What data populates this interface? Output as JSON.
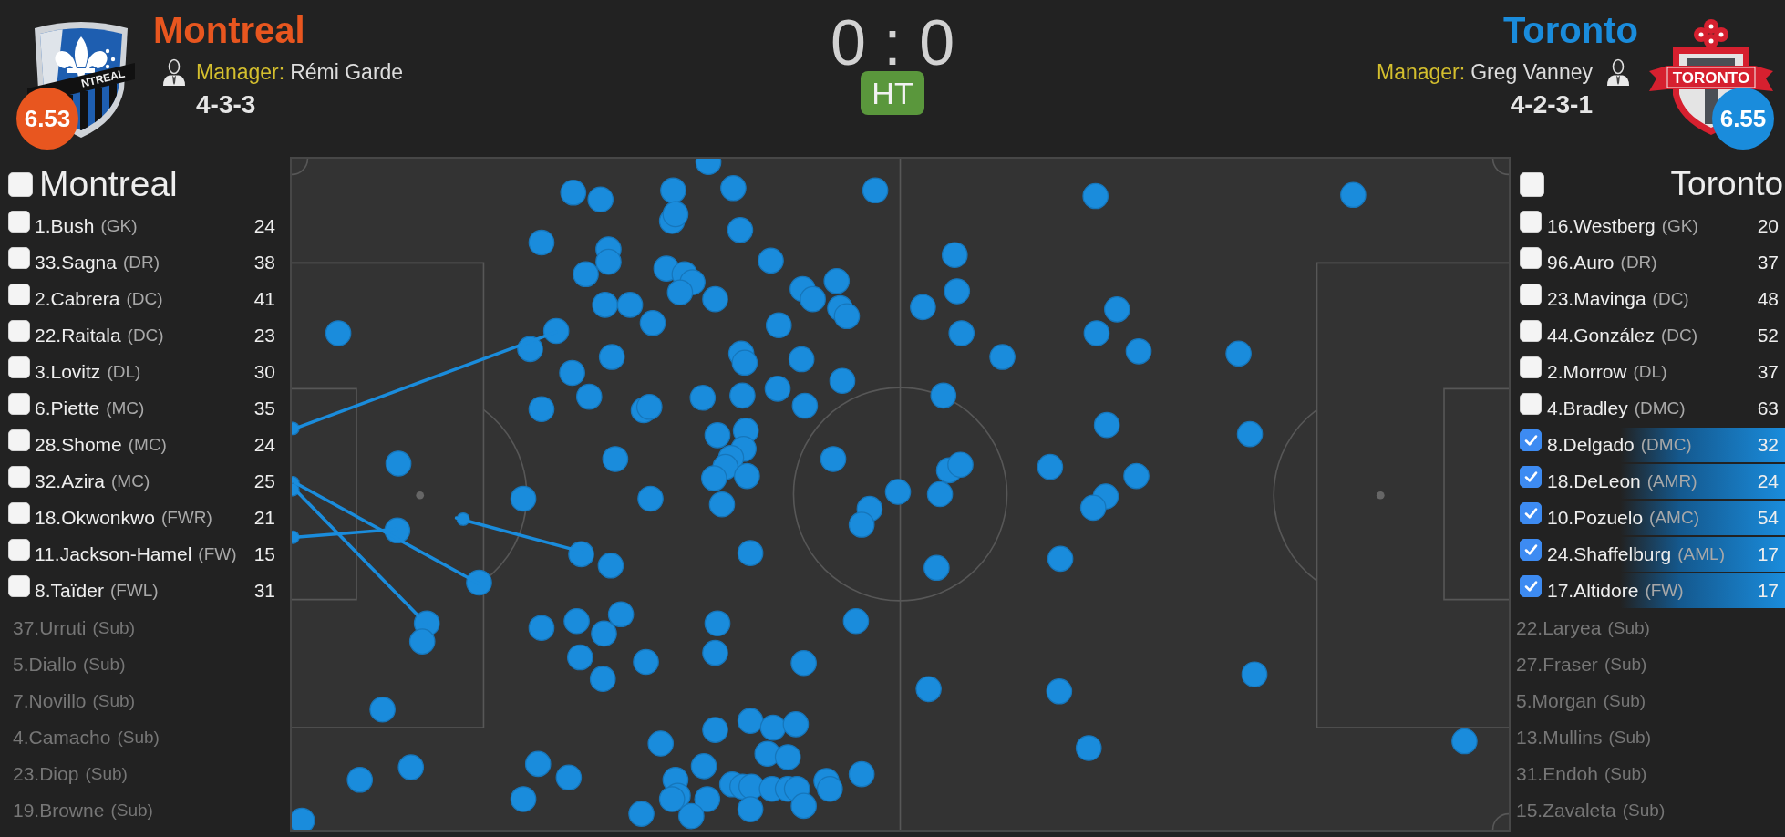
{
  "teams": [
    {
      "name": "Montreal",
      "color": "#e8561f",
      "rating": "6.53",
      "crest_text": "NTREAL",
      "manager_label": "Manager:",
      "manager": "Rémi Garde",
      "formation": "4-3-3",
      "list_title": "Montreal",
      "checked": false,
      "players": [
        {
          "name": "1.Bush",
          "position": "(GK)",
          "stat": "24",
          "checked": false
        },
        {
          "name": "33.Sagna",
          "position": "(DR)",
          "stat": "38",
          "checked": false
        },
        {
          "name": "2.Cabrera",
          "position": "(DC)",
          "stat": "41",
          "checked": false
        },
        {
          "name": "22.Raitala",
          "position": "(DC)",
          "stat": "23",
          "checked": false
        },
        {
          "name": "3.Lovitz",
          "position": "(DL)",
          "stat": "30",
          "checked": false
        },
        {
          "name": "6.Piette",
          "position": "(MC)",
          "stat": "35",
          "checked": false
        },
        {
          "name": "28.Shome",
          "position": "(MC)",
          "stat": "24",
          "checked": false
        },
        {
          "name": "32.Azira",
          "position": "(MC)",
          "stat": "25",
          "checked": false
        },
        {
          "name": "18.Okwonkwo",
          "position": "(FWR)",
          "stat": "21",
          "checked": false
        },
        {
          "name": "11.Jackson-Hamel",
          "position": "(FW)",
          "stat": "15",
          "checked": false
        },
        {
          "name": "8.Taïder",
          "position": "(FWL)",
          "stat": "31",
          "checked": false
        }
      ],
      "substitutes": [
        {
          "name": "37.Urruti",
          "position": "(Sub)"
        },
        {
          "name": "5.Diallo",
          "position": "(Sub)"
        },
        {
          "name": "7.Novillo",
          "position": "(Sub)"
        },
        {
          "name": "4.Camacho",
          "position": "(Sub)"
        },
        {
          "name": "23.Diop",
          "position": "(Sub)"
        },
        {
          "name": "19.Browne",
          "position": "(Sub)"
        }
      ]
    },
    {
      "name": "Toronto",
      "color": "#1a8cdc",
      "rating": "6.55",
      "crest_text": "TORONTO",
      "manager_label": "Manager:",
      "manager": "Greg Vanney",
      "formation": "4-2-3-1",
      "list_title": "Toronto",
      "checked": false,
      "players": [
        {
          "name": "16.Westberg",
          "position": "(GK)",
          "stat": "20",
          "checked": false
        },
        {
          "name": "96.Auro",
          "position": "(DR)",
          "stat": "37",
          "checked": false
        },
        {
          "name": "23.Mavinga",
          "position": "(DC)",
          "stat": "48",
          "checked": false
        },
        {
          "name": "44.González",
          "position": "(DC)",
          "stat": "52",
          "checked": false
        },
        {
          "name": "2.Morrow",
          "position": "(DL)",
          "stat": "37",
          "checked": false
        },
        {
          "name": "4.Bradley",
          "position": "(DMC)",
          "stat": "63",
          "checked": false
        },
        {
          "name": "8.Delgado",
          "position": "(DMC)",
          "stat": "32",
          "checked": true
        },
        {
          "name": "18.DeLeon",
          "position": "(AMR)",
          "stat": "24",
          "checked": true
        },
        {
          "name": "10.Pozuelo",
          "position": "(AMC)",
          "stat": "54",
          "checked": true
        },
        {
          "name": "24.Shaffelburg",
          "position": "(AML)",
          "stat": "17",
          "checked": true
        },
        {
          "name": "17.Altidore",
          "position": "(FW)",
          "stat": "17",
          "checked": true
        }
      ],
      "substitutes": [
        {
          "name": "22.Laryea",
          "position": "(Sub)"
        },
        {
          "name": "27.Fraser",
          "position": "(Sub)"
        },
        {
          "name": "5.Morgan",
          "position": "(Sub)"
        },
        {
          "name": "13.Mullins",
          "position": "(Sub)"
        },
        {
          "name": "31.Endoh",
          "position": "(Sub)"
        },
        {
          "name": "15.Zavaleta",
          "position": "(Sub)"
        }
      ]
    }
  ],
  "match": {
    "score": "0 : 0",
    "status": "HT"
  }
}
